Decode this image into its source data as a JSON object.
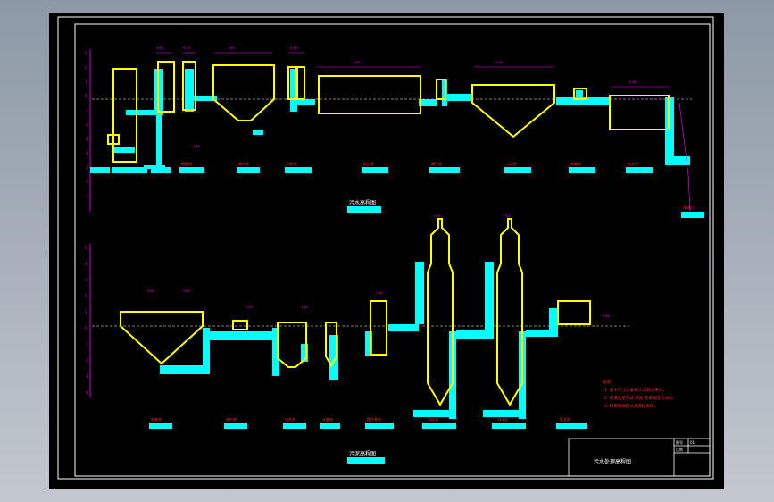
{
  "drawing": {
    "top_view_title": "污水高程图",
    "bottom_view_title": "污泥高程图",
    "top_section_labels": [
      "格栅间",
      "调节池",
      "沉砂池",
      "初沉池",
      "曝气池",
      "二沉池",
      "消毒池",
      "出水井",
      "排放口"
    ],
    "bottom_section_labels": [
      "浓缩池",
      "调节池",
      "均质池",
      "计量池",
      "提升泵房",
      "消化池",
      "消化池",
      "贮泥池"
    ],
    "notes": {
      "heading": "说明：",
      "lines": [
        "1. 图中尺寸以毫米计,高程以米计。",
        "2. 管道连接方式 焊接 管道坡度 0.003",
        "3. 构筑物高程以池底标高计。"
      ]
    },
    "title_block": {
      "drawing_title": "污水处理高程图",
      "fields": [
        {
          "label": "图号",
          "value": "01"
        },
        {
          "label": "比例",
          "value": ""
        }
      ]
    }
  },
  "colors": {
    "background": "#000000",
    "frame": "#ffffff",
    "structure": "#ffff00",
    "water": "#00ffff",
    "dimension": "#ff00ff",
    "note_text": "#ff3030",
    "grid": "#cc0000"
  }
}
